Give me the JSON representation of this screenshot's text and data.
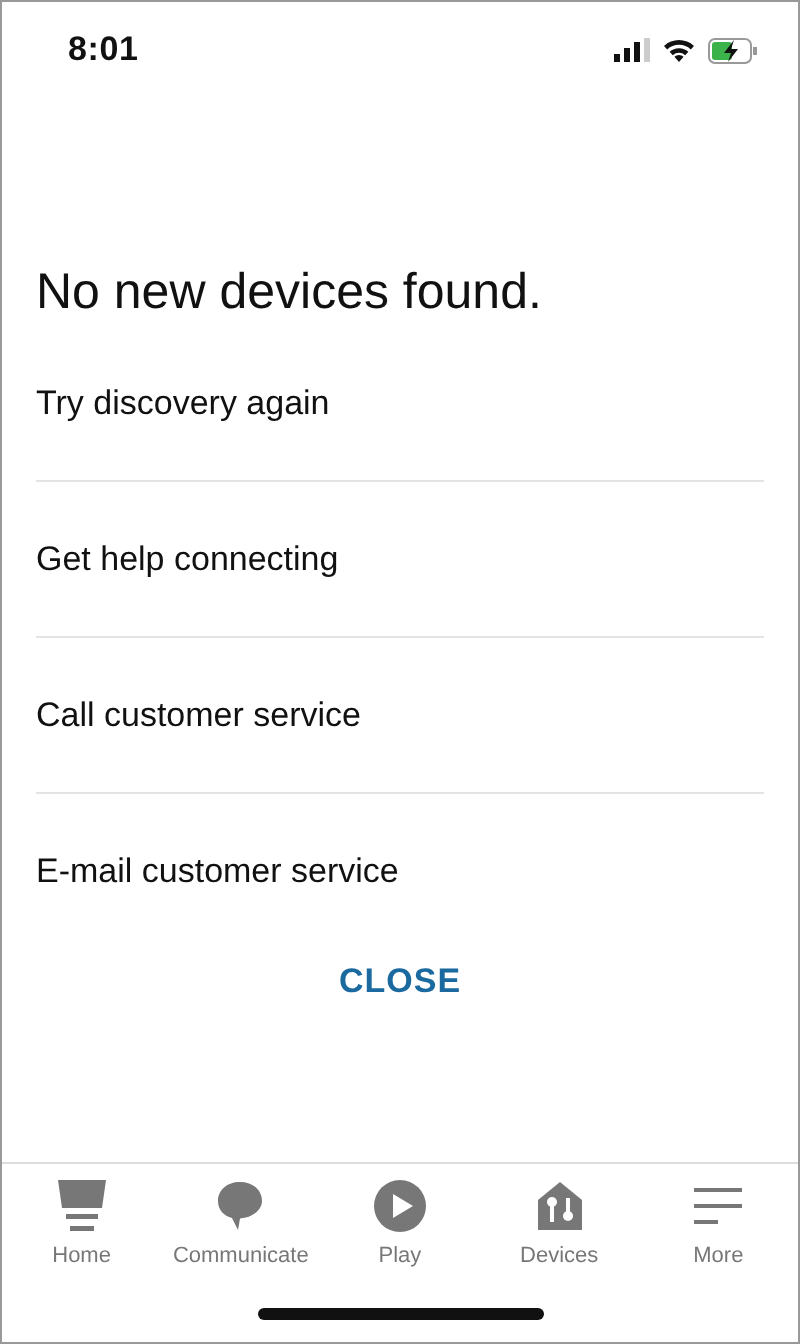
{
  "status_bar": {
    "time": "8:01"
  },
  "heading": "No new devices found.",
  "options": [
    {
      "label": "Try discovery again"
    },
    {
      "label": "Get help connecting"
    },
    {
      "label": "Call customer service"
    },
    {
      "label": "E-mail customer service"
    }
  ],
  "close_button": "CLOSE",
  "tab_bar": [
    {
      "label": "Home",
      "kind": "home"
    },
    {
      "label": "Communicate",
      "kind": "communicate"
    },
    {
      "label": "Play",
      "kind": "play"
    },
    {
      "label": "Devices",
      "kind": "devices"
    },
    {
      "label": "More",
      "kind": "more"
    }
  ]
}
